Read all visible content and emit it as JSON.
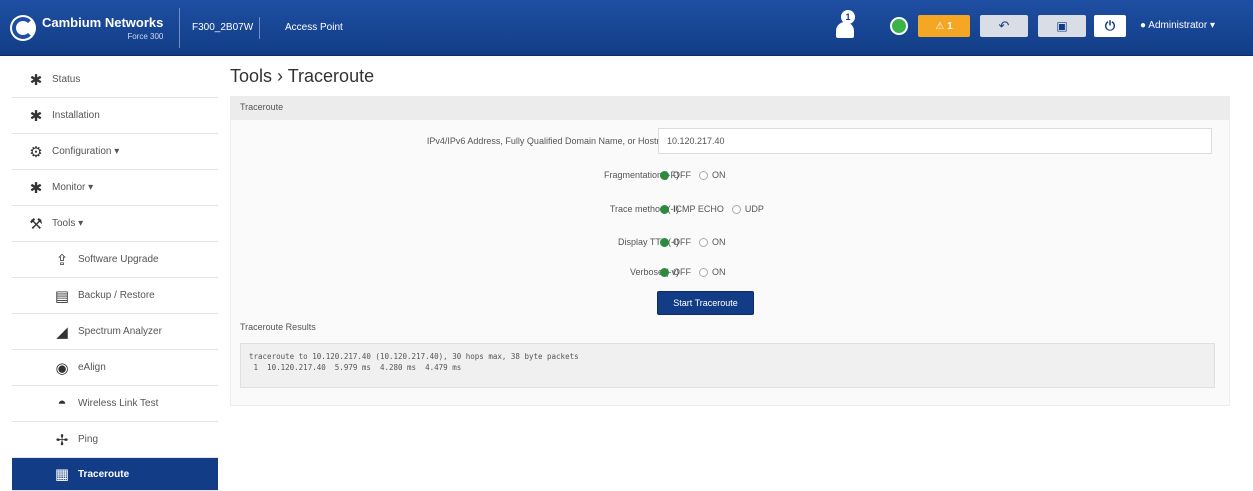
{
  "header": {
    "brand": "Cambium Networks",
    "brand_sub": "Force 300",
    "device_name": "F300_2B07W",
    "mode": "Access Point",
    "notification_count": "1",
    "warning_count": "1",
    "user": "Administrator",
    "colors": {
      "bar": "#123d86",
      "warning": "#f5a623",
      "status_ok": "#3cb34a"
    }
  },
  "sidebar": {
    "items": [
      {
        "label": "Status",
        "icon": "pulse-icon"
      },
      {
        "label": "Installation",
        "icon": "install-icon"
      },
      {
        "label": "Configuration",
        "icon": "gear-icon"
      },
      {
        "label": "Monitor",
        "icon": "monitor-icon"
      },
      {
        "label": "Tools",
        "icon": "wrench-icon"
      },
      {
        "label": "Software Upgrade",
        "icon": "upgrade-icon"
      },
      {
        "label": "Backup / Restore",
        "icon": "backup-icon"
      },
      {
        "label": "Spectrum Analyzer",
        "icon": "spectrum-icon"
      },
      {
        "label": "eAlign",
        "icon": "align-icon"
      },
      {
        "label": "Wireless Link Test",
        "icon": "link-test-icon"
      },
      {
        "label": "Ping",
        "icon": "ping-icon"
      },
      {
        "label": "Traceroute",
        "icon": "traceroute-icon"
      }
    ]
  },
  "page": {
    "title": "Tools",
    "subtitle": "Traceroute",
    "section_title": "Traceroute"
  },
  "form": {
    "address_label": "IPv4/IPv6 Address, Fully Qualified Domain Name, or Hostname",
    "address_value": "10.120.217.40",
    "fragmentation_label": "Fragmentation (-F)",
    "fragmentation_options": [
      "OFF",
      "ON"
    ],
    "fragmentation_selected": "OFF",
    "trace_method_label": "Trace method (-I)",
    "trace_method_options": [
      "ICMP ECHO",
      "UDP"
    ],
    "trace_method_selected": "ICMP ECHO",
    "display_ttl_label": "Display TTL (-l)",
    "display_ttl_options": [
      "OFF",
      "ON"
    ],
    "display_ttl_selected": "OFF",
    "verbose_label": "Verbose (-v)",
    "verbose_options": [
      "OFF",
      "ON"
    ],
    "verbose_selected": "OFF",
    "start_button": "Start Traceroute"
  },
  "results": {
    "label": "Traceroute Results",
    "output": "traceroute to 10.120.217.40 (10.120.217.40), 30 hops max, 38 byte packets\n 1  10.120.217.40  5.979 ms  4.280 ms  4.479 ms"
  }
}
